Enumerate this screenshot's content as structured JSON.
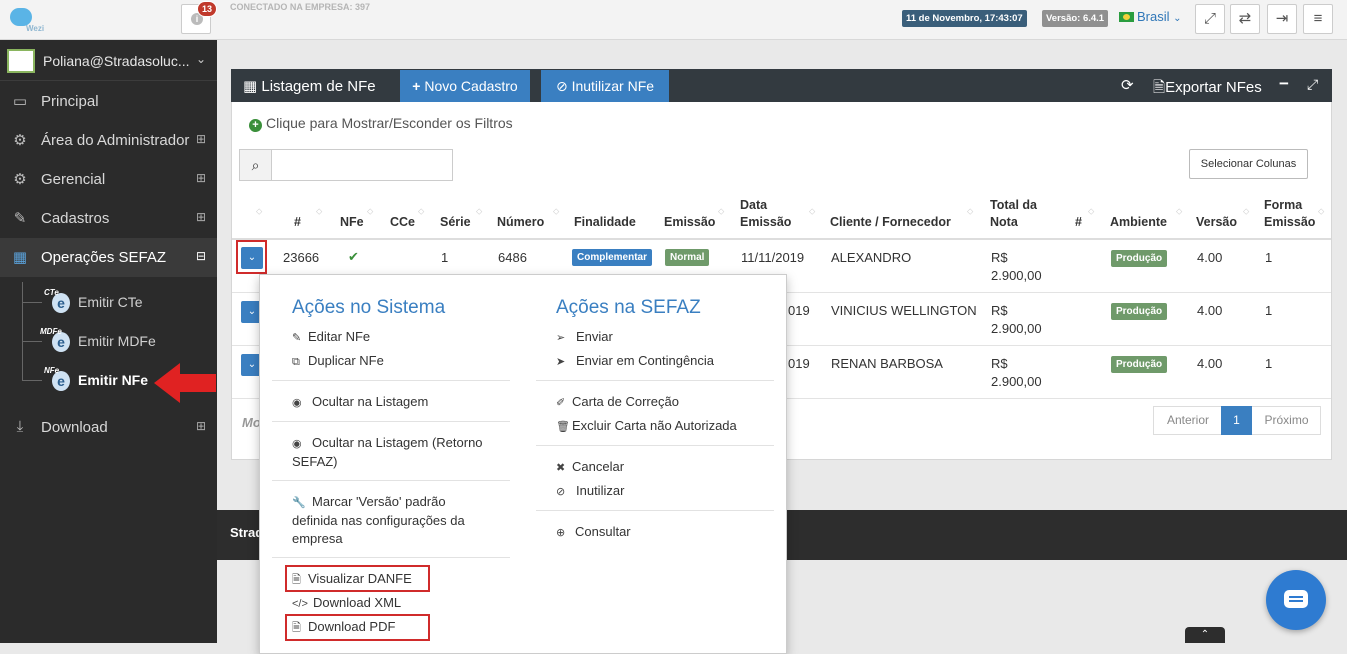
{
  "topbar": {
    "logo_text": "Wezi",
    "notifications": "13",
    "company": "CONECTADO NA EMPRESA: 397",
    "datetime": "11 de Novembro, 17:43:07",
    "version": "Versão: 6.4.1",
    "country": "Brasil"
  },
  "sidebar": {
    "username": "Poliana@Stradasoluc...",
    "items": [
      {
        "label": "Principal",
        "icon": "laptop-icon"
      },
      {
        "label": "Área do Administrador",
        "icon": "cogs-icon"
      },
      {
        "label": "Gerencial",
        "icon": "cogs-icon"
      },
      {
        "label": "Cadastros",
        "icon": "edit-icon"
      },
      {
        "label": "Operações SEFAZ",
        "icon": "windows-icon"
      },
      {
        "label": "Download",
        "icon": "download-icon"
      }
    ],
    "subitems": [
      {
        "label": "Emitir CTe",
        "badge": "CTe"
      },
      {
        "label": "Emitir MDFe",
        "badge": "MDFe"
      },
      {
        "label": "Emitir NFe",
        "badge": "NFe"
      }
    ]
  },
  "panel": {
    "title": "Listagem de NFe",
    "new_button": "Novo Cadastro",
    "void_button": "Inutilizar NFe",
    "export": "Exportar NFes",
    "filters_toggle": "Clique para Mostrar/Esconder os Filtros",
    "select_columns": "Selecionar Colunas"
  },
  "table": {
    "headers": [
      "#",
      "NFe",
      "CCe",
      "Série",
      "Número",
      "Finalidade",
      "Emissão",
      "Data\nEmissão",
      "Cliente / Fornecedor",
      "Total da\nNota",
      "#",
      "Ambiente",
      "Versão",
      "Forma\nEmissão"
    ],
    "rows": [
      {
        "id": "23666",
        "serie": "1",
        "numero": "6486",
        "finalidade": "Complementar",
        "emissao": "Normal",
        "data": "11/11/2019",
        "cliente": "ALEXANDRO",
        "total_cur": "R$",
        "total": "2.900,00",
        "ambiente": "Produção",
        "versao": "4.00",
        "forma": "1"
      },
      {
        "data_partial": "019",
        "cliente": "VINICIUS WELLINGTON",
        "total_cur": "R$",
        "total": "2.900,00",
        "ambiente": "Produção",
        "versao": "4.00",
        "forma": "1"
      },
      {
        "data_partial": "019",
        "cliente": "RENAN BARBOSA",
        "total_cur": "R$",
        "total": "2.900,00",
        "ambiente": "Produção",
        "versao": "4.00",
        "forma": "1"
      }
    ],
    "footer_partial": "Mo"
  },
  "pagination": {
    "prev": "Anterior",
    "current": "1",
    "next": "Próximo"
  },
  "footer_text": "Strad",
  "menu": {
    "sistema_title": "Ações no Sistema",
    "sefaz_title": "Ações na SEFAZ",
    "sistema": [
      "Editar NFe",
      "Duplicar NFe",
      "Ocultar na Listagem",
      "Ocultar na Listagem (Retorno SEFAZ)",
      "Marcar 'Versão' padrão definida nas configurações da empresa",
      "Visualizar DANFE",
      "Download XML",
      "Download PDF"
    ],
    "sefaz": [
      "Enviar",
      "Enviar em Contingência",
      "Carta de Correção",
      "Excluir Carta não Autorizada",
      "Cancelar",
      "Inutilizar",
      "Consultar"
    ]
  }
}
